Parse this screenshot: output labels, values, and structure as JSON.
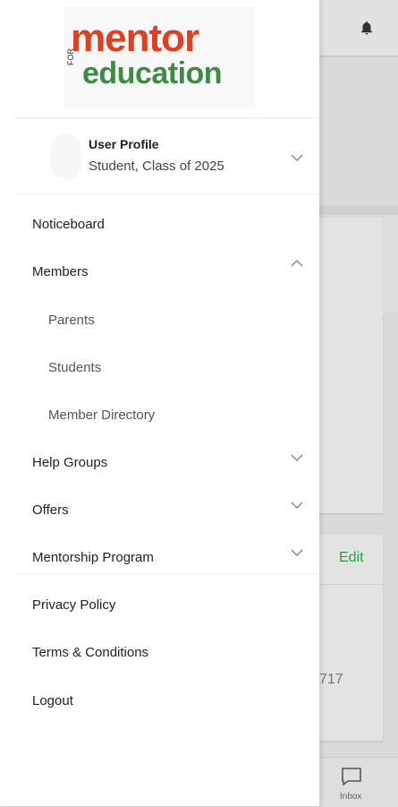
{
  "background": {
    "edit_label": "Edit",
    "partial_number": "717",
    "inbox_label": "Inbox"
  },
  "logo": {
    "mentor": "mentor",
    "for": "FOR",
    "education": "education"
  },
  "profile": {
    "name": "User Profile",
    "subtitle": "Student, Class of 2025"
  },
  "menu": {
    "noticeboard": "Noticeboard",
    "members": "Members",
    "members_sub": [
      "Parents",
      "Students",
      "Member Directory"
    ],
    "help_groups": "Help Groups",
    "offers": "Offers",
    "mentorship": "Mentorship Program",
    "privacy": "Privacy Policy",
    "terms": "Terms & Conditions",
    "logout": "Logout"
  },
  "colors": {
    "brand_orange": "#e0401e",
    "brand_green": "#3c8c44",
    "accent_green": "#2e9a4a"
  }
}
